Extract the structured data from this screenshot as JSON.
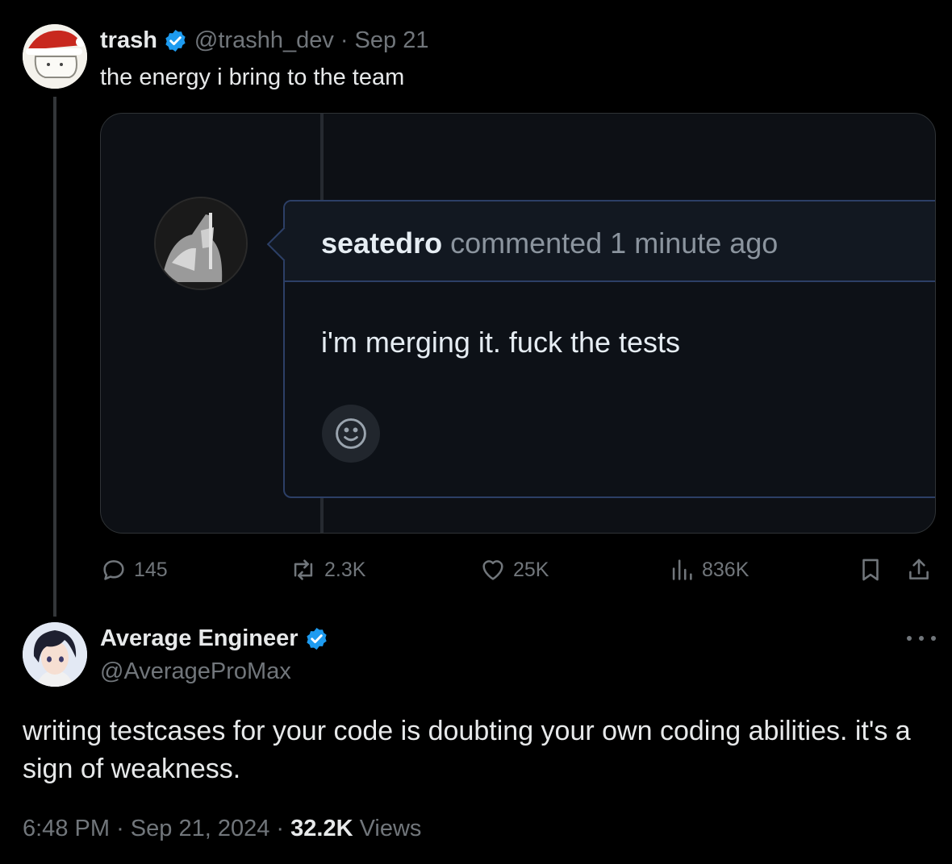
{
  "parent_tweet": {
    "name": "trash",
    "handle": "@trashh_dev",
    "separator": "·",
    "date": "Sep 21",
    "text": "the energy i bring to the team",
    "media": {
      "user": "seatedro",
      "meta": "commented 1 minute ago",
      "comment": "i'm merging it. fuck the tests",
      "emoji_icon": "smiley-icon"
    },
    "actions": {
      "replies": "145",
      "reposts": "2.3K",
      "likes": "25K",
      "views": "836K"
    }
  },
  "main_tweet": {
    "name": "Average Engineer",
    "handle": "@AverageProMax",
    "text": "writing testcases for your code is doubting your own coding abilities. it's a sign of weakness.",
    "time": "6:48 PM",
    "separator": "·",
    "date": "Sep 21, 2024",
    "views_count": "32.2K",
    "views_label": "Views"
  },
  "colors": {
    "background": "#000000",
    "text_primary": "#e7e9ea",
    "text_secondary": "#71767b",
    "verified": "#1d9bf0",
    "github_border": "#2c3f66"
  }
}
